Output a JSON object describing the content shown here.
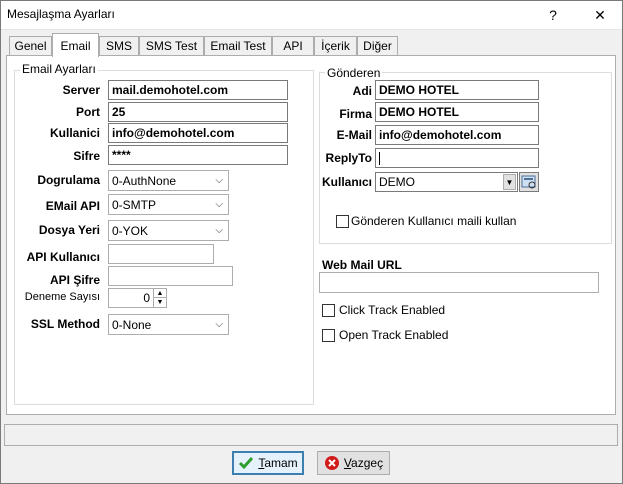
{
  "window": {
    "title": "Mesajlaşma Ayarları",
    "help_btn": "?",
    "close_btn": "✕"
  },
  "tabs": [
    "Genel",
    "Email",
    "SMS",
    "SMS Test",
    "Email Test",
    "API",
    "İçerik",
    "Diğer"
  ],
  "active_tab": "Email",
  "email_group": {
    "title": "Email Ayarları",
    "server_label": "Server",
    "server_value": "mail.demohotel.com",
    "port_label": "Port",
    "port_value": "25",
    "user_label": "Kullanici",
    "user_value": "info@demohotel.com",
    "pass_label": "Sifre",
    "pass_value": "****",
    "auth_label": "Dogrulama",
    "auth_value": "0-AuthNone",
    "api_label": "EMail API",
    "api_value": "0-SMTP",
    "folder_label": "Dosya Yeri",
    "folder_value": "0-YOK",
    "api_user_label": "API Kullanıcı",
    "api_user_value": "",
    "api_pass_label": "API Şifre",
    "api_pass_value": "",
    "retry_label": "Deneme Sayısı",
    "retry_value": "0",
    "ssl_label": "SSL Method",
    "ssl_value": "0-None"
  },
  "sender_group": {
    "title": "Gönderen",
    "name_label": "Adi",
    "name_value": "DEMO HOTEL",
    "company_label": "Firma",
    "company_value": "DEMO HOTEL",
    "email_label": "E-Mail",
    "email_value": "info@demohotel.com",
    "replyto_label": "ReplyTo",
    "replyto_value": "",
    "user_label": "Kullanıcı",
    "user_value": "DEMO",
    "use_user_mail_label": "Gönderen Kullanıcı maili kullan",
    "use_user_mail_checked": false
  },
  "webmail": {
    "label": "Web Mail URL",
    "value": ""
  },
  "click_track": {
    "label": "Click Track Enabled",
    "checked": false
  },
  "open_track": {
    "label": "Open Track Enabled",
    "checked": false
  },
  "buttons": {
    "ok_label": "Tamam",
    "ok_mnemonic": "T",
    "ok_rest": "amam",
    "cancel_mnemonic": "V",
    "cancel_rest": "azgeç",
    "cancel_label": "Vazgeç"
  },
  "colors": {
    "ok_green": "#2e9e2e",
    "cancel_red": "#d11a1a",
    "accent": "#3c7fb1"
  }
}
